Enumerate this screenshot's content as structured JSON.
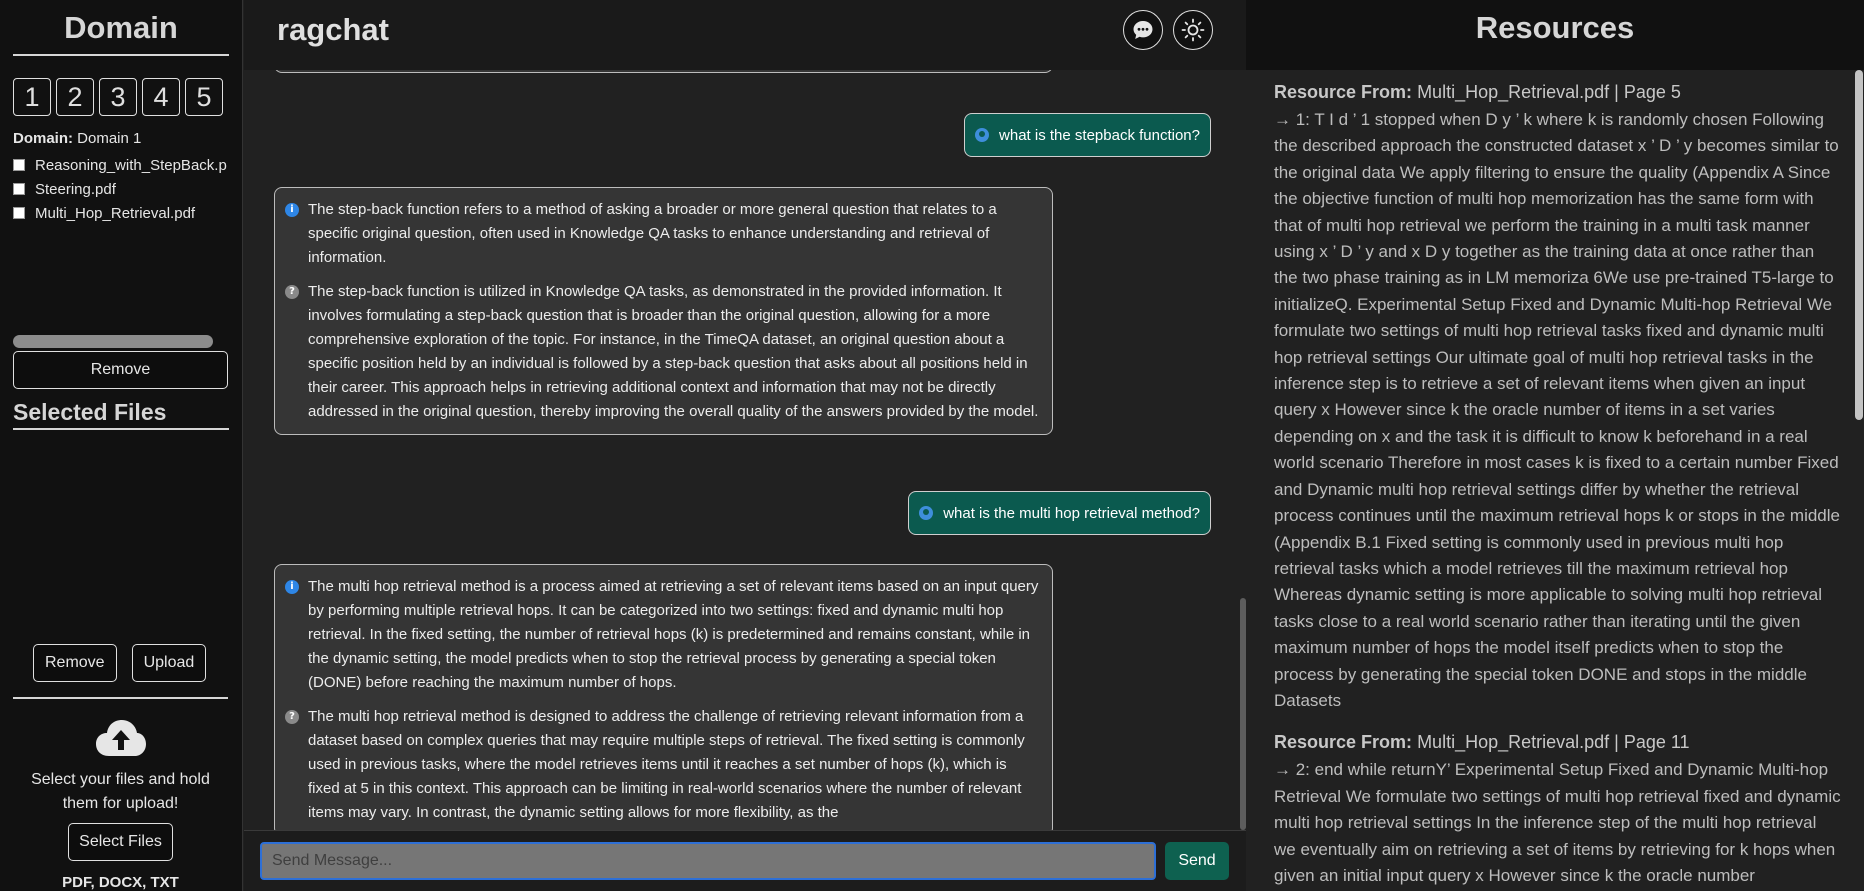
{
  "sidebar": {
    "title": "Domain",
    "domain_buttons": [
      "1",
      "2",
      "3",
      "4",
      "5"
    ],
    "domain_label": "Domain:",
    "domain_value": "Domain 1",
    "files": [
      "Reasoning_with_StepBack.p",
      "Steering.pdf",
      "Multi_Hop_Retrieval.pdf"
    ],
    "remove_label": "Remove",
    "selected_files_title": "Selected Files",
    "remove2_label": "Remove",
    "upload_label": "Upload",
    "upload_hint": "Select your files and hold them for upload!",
    "select_files_label": "Select Files",
    "formats": "PDF, DOCX, TXT",
    "upload_icon": "cloud-upload-icon"
  },
  "chat": {
    "title": "ragchat",
    "header_icons": [
      "chat-bubble-icon",
      "sun-icon"
    ],
    "messages": [
      {
        "role": "user",
        "text": "what is the stepback function?"
      },
      {
        "role": "bot",
        "paragraphs": [
          {
            "icon": "info-icon",
            "text": "The step-back function refers to a method of asking a broader or more general question that relates to a specific original question, often used in Knowledge QA tasks to enhance understanding and retrieval of information."
          },
          {
            "icon": "question-icon",
            "text": "The step-back function is utilized in Knowledge QA tasks, as demonstrated in the provided information. It involves formulating a step-back question that is broader than the original question, allowing for a more comprehensive exploration of the topic. For instance, in the TimeQA dataset, an original question about a specific position held by an individual is followed by a step-back question that asks about all positions held in their career. This approach helps in retrieving additional context and information that may not be directly addressed in the original question, thereby improving the overall quality of the answers provided by the model."
          }
        ]
      },
      {
        "role": "user",
        "text": "what is the multi hop retrieval method?"
      },
      {
        "role": "bot",
        "paragraphs": [
          {
            "icon": "info-icon",
            "text": "The multi hop retrieval method is a process aimed at retrieving a set of relevant items based on an input query by performing multiple retrieval hops. It can be categorized into two settings: fixed and dynamic multi hop retrieval. In the fixed setting, the number of retrieval hops (k) is predetermined and remains constant, while in the dynamic setting, the model predicts when to stop the retrieval process by generating a special token (DONE) before reaching the maximum number of hops."
          },
          {
            "icon": "question-icon",
            "text": "The multi hop retrieval method is designed to address the challenge of retrieving relevant information from a dataset based on complex queries that may require multiple steps of retrieval. The fixed setting is commonly used in previous tasks, where the model retrieves items until it reaches a set number of hops (k), which is fixed at 5 in this context. This approach can be limiting in real-world scenarios where the number of relevant items may vary. In contrast, the dynamic setting allows for more flexibility, as the"
          }
        ]
      }
    ],
    "input_placeholder": "Send Message...",
    "send_label": "Send"
  },
  "resources": {
    "title": "Resources",
    "items": [
      {
        "label": "Resource From:",
        "source": "Multi_Hop_Retrieval.pdf | Page 5",
        "text": "→ 1: T I d ’ 1 stopped when D y ’ k where k is randomly chosen Following the described approach the constructed dataset x ’ D ’ y becomes similar to the original data We apply filtering to ensure the quality (Appendix A Since the objective function of multi hop memorization has the same form with that of multi hop retrieval we perform the training in a multi task manner using x ’ D ’ y and x D y together as the training data at once rather than the two phase training as in LM memoriza 6We use pre-trained T5-large to initializeQ. Experimental Setup Fixed and Dynamic Multi-hop Retrieval We formulate two settings of multi hop retrieval tasks fixed and dynamic multi hop retrieval settings Our ultimate goal of multi hop retrieval tasks in the inference step is to retrieve a set of relevant items when given an input query x However since k the oracle number of items in a set varies depending on x and the task it is difficult to know k beforehand in a real world scenario Therefore in most cases k is fixed to a certain number Fixed and Dynamic multi hop retrieval settings differ by whether the retrieval process continues until the maximum retrieval hops k or stops in the middle (Appendix B.1 Fixed setting is commonly used in previous multi hop retrieval tasks which a model retrieves till the maximum retrieval hop Whereas dynamic setting is more applicable to solving multi hop retrieval tasks close to a real world scenario rather than iterating until the given maximum number of hops the model itself predicts when to stop the process by generating the special token DONE and stops in the middle Datasets"
      },
      {
        "label": "Resource From:",
        "source": "Multi_Hop_Retrieval.pdf | Page 11",
        "text": "→ 2: end while returnY’ Experimental Setup Fixed and Dynamic Multi-hop Retrieval We formulate two settings of multi hop retrieval fixed and dynamic multi hop retrieval settings In the inference step of the multi hop retrieval we eventually aim on retrieving a set of items by retrieving for k hops when given an initial input query x However since k the oracle number"
      }
    ]
  }
}
